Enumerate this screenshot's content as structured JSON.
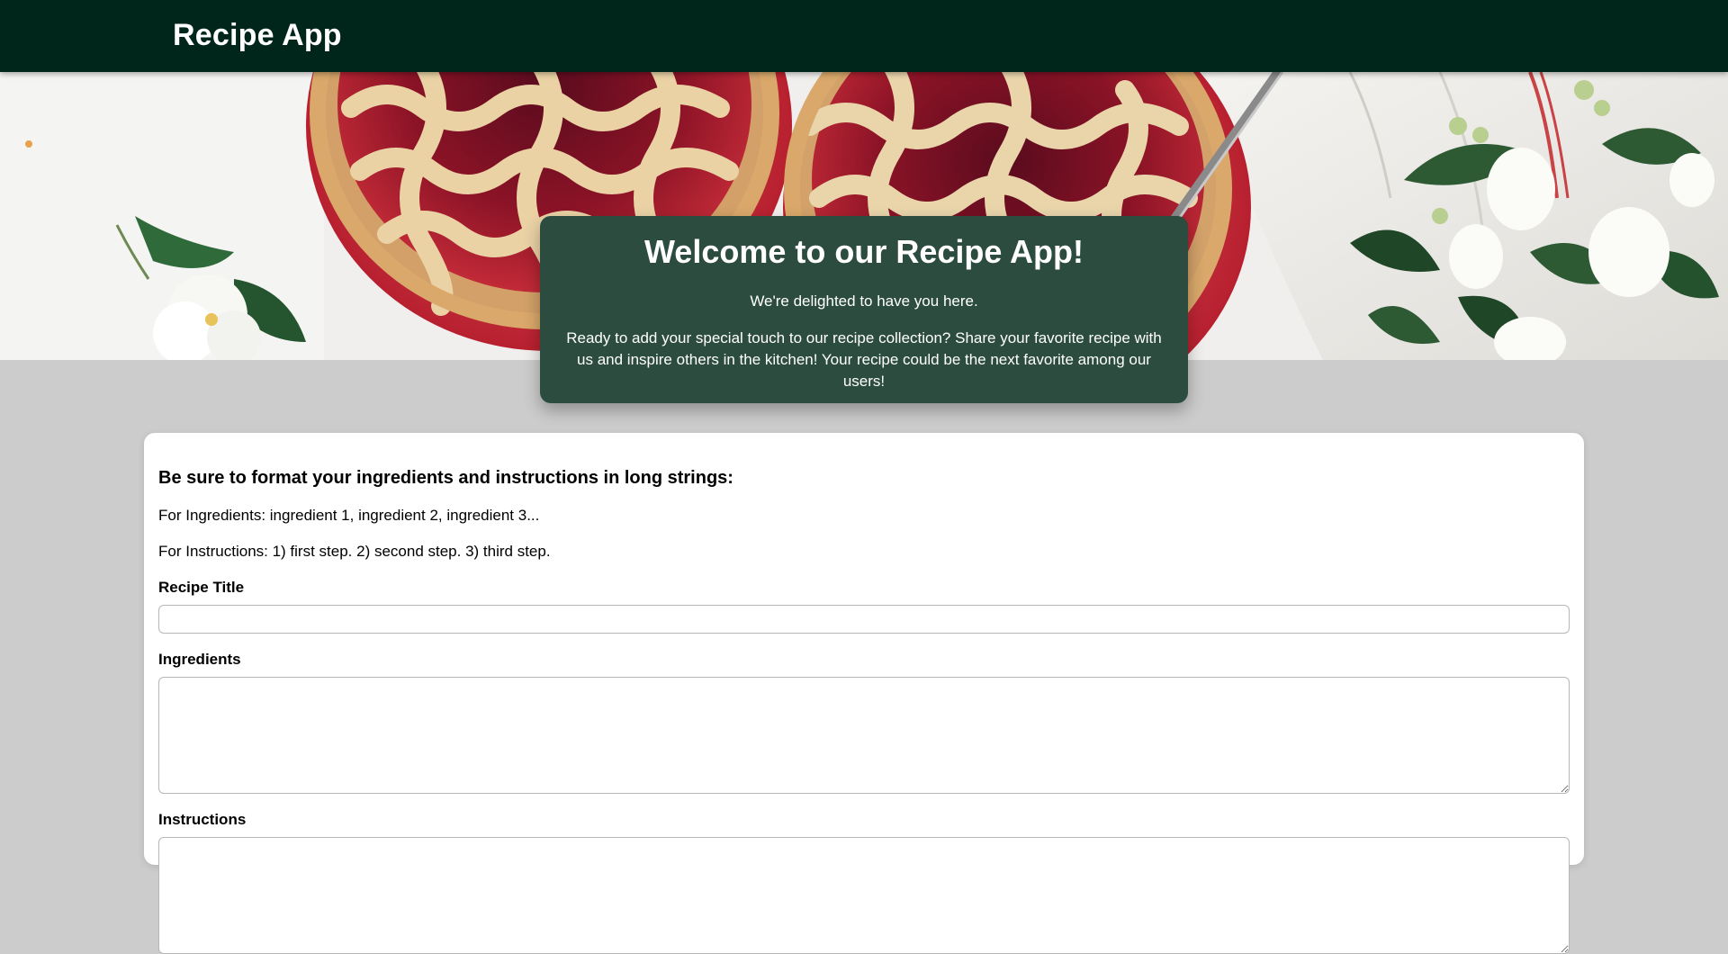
{
  "nav": {
    "brand": "Recipe App"
  },
  "hero": {
    "image_icon": "berry-pie-photo"
  },
  "welcome": {
    "title": "Welcome to our Recipe App!",
    "greeting": "We're delighted to have you here.",
    "pitch": "Ready to add your special touch to our recipe collection? Share your favorite recipe with us and inspire others in the kitchen! Your recipe could be the next favorite among our users!"
  },
  "form": {
    "heading": "Be sure to format your ingredients and instructions in long strings:",
    "ingredients_hint": "For Ingredients: ingredient 1, ingredient 2, ingredient 3...",
    "instructions_hint": "For Instructions: 1) first step. 2) second step. 3) third step.",
    "title_label": "Recipe Title",
    "title_value": "",
    "ingredients_label": "Ingredients",
    "ingredients_value": "",
    "instructions_label": "Instructions",
    "instructions_value": ""
  },
  "colors": {
    "navbar": "#00261b",
    "welcome_panel": "#2c4c40",
    "page_background": "#cccccc",
    "card": "#ffffff"
  }
}
